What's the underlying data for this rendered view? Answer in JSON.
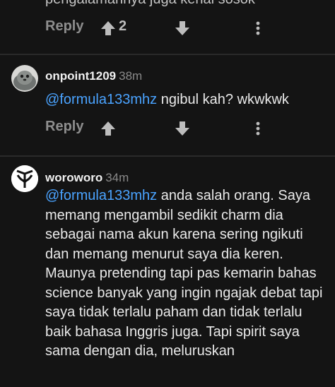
{
  "top_comment": {
    "cut_text": "pengalamannya juga kenal sosok",
    "actions": {
      "reply_label": "Reply",
      "upvote_count": "2"
    }
  },
  "comments": [
    {
      "author": "onpoint1209",
      "time": "38m",
      "mention": "@formula133mhz",
      "text": " ngibul kah? wkwkwk",
      "actions": {
        "reply_label": "Reply",
        "upvote_count": ""
      }
    },
    {
      "author": "woroworo",
      "time": "34m",
      "mention": "@formula133mhz",
      "lines": [
        " anda salah orang. Saya",
        "memang mengambil sedikit charm dia",
        "sebagai nama akun karena sering ngikuti",
        "dan memang menurut saya dia keren.",
        "Maunya pretending tapi pas kemarin bahas",
        "science banyak yang ingin ngajak debat tapi",
        "saya tidak terlalu paham dan tidak terlalu",
        "baik bahasa Inggris juga. Tapi spirit saya",
        "sama dengan dia, meluruskan"
      ]
    }
  ],
  "icons": {
    "upvote": "arrow-up-icon",
    "downvote": "arrow-down-icon",
    "more": "more-vertical-icon"
  },
  "colors": {
    "background": "#141414",
    "mention": "#4aa3ff",
    "muted": "#8e8e8e",
    "divider": "#2a2a2a"
  }
}
